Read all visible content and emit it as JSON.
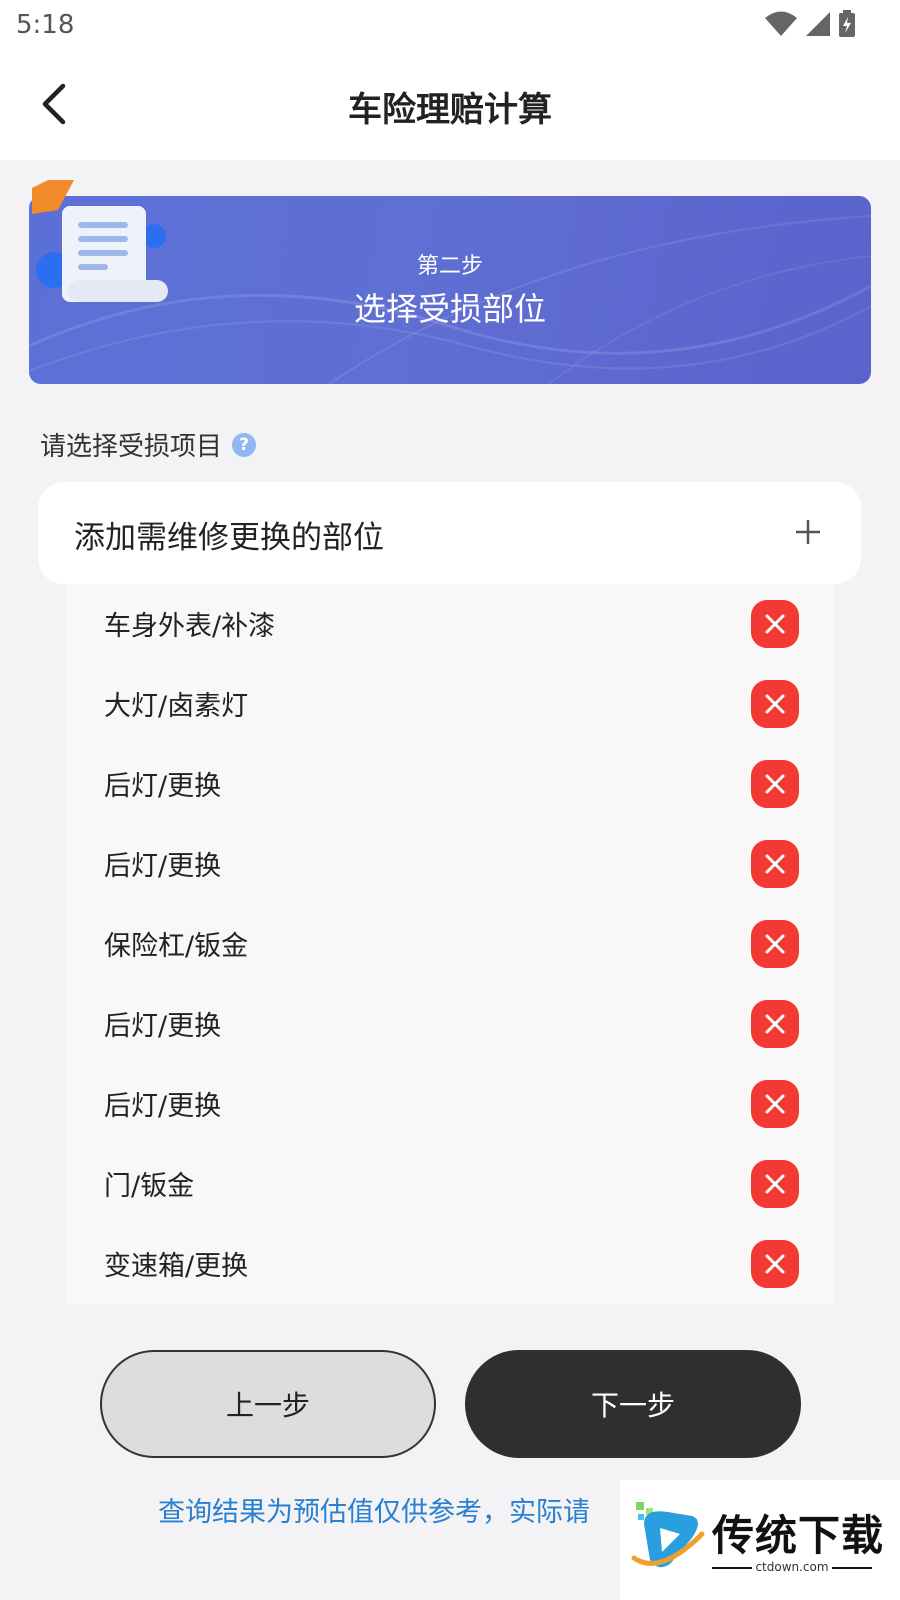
{
  "status_bar": {
    "time": "5:18"
  },
  "nav": {
    "title": "车险理赔计算"
  },
  "banner": {
    "step": "第二步",
    "title": "选择受损部位"
  },
  "section": {
    "label": "请选择受损项目",
    "help_glyph": "?"
  },
  "add_card": {
    "label": "添加需维修更换的部位"
  },
  "items": [
    "车身外表/补漆",
    "大灯/卤素灯",
    "后灯/更换",
    "后灯/更换",
    "保险杠/钣金",
    "后灯/更换",
    "后灯/更换",
    "门/钣金",
    "变速箱/更换"
  ],
  "buttons": {
    "prev": "上一步",
    "next": "下一步"
  },
  "disclaimer": "查询结果为预估值仅供参考，实际请",
  "watermark": {
    "name": "传统下载",
    "url": "ctdown.com"
  },
  "colors": {
    "accent_red": "#f03a33",
    "banner_blue": "#5b6bd4",
    "link_blue": "#2a7fd0",
    "dark_button": "#2f2f2f"
  }
}
